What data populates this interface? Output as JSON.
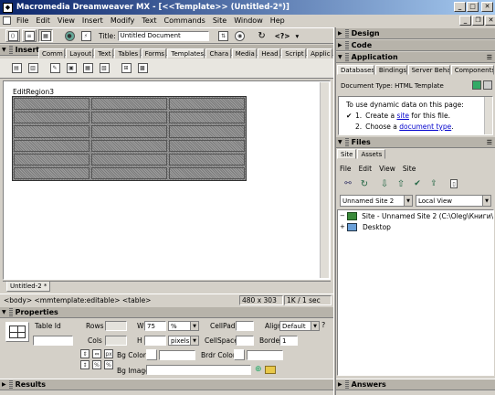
{
  "window": {
    "title": "Macromedia Dreamweaver MX - [<<Template>> (Untitled-2*)]"
  },
  "menu": [
    "File",
    "Edit",
    "View",
    "Insert",
    "Modify",
    "Text",
    "Commands",
    "Site",
    "Window",
    "Hep"
  ],
  "doc_toolbar": {
    "title_label": "Title:",
    "title_value": "Untitled Document",
    "codenav": "<?>"
  },
  "insert_panel": {
    "header": "Insert",
    "tabs": [
      "Comm",
      "Layout",
      "Text",
      "Tables",
      "Forms",
      "Templates",
      "Chara",
      "Media",
      "Head",
      "Script",
      "Applic"
    ],
    "active_tab": "Templates"
  },
  "document": {
    "region_label": "EditRegion3",
    "table_rows": 6,
    "table_cols": 3,
    "tab": "Untitled-2 *"
  },
  "status": {
    "path": "<body> <mmtemplate:editable> <table>",
    "size": "480 x 303",
    "info": "1K / 1 sec"
  },
  "properties": {
    "header": "Properties",
    "table_label": "Table Id",
    "rows_label": "Rows",
    "cols_label": "Cols",
    "w_label": "W",
    "w_value": "75",
    "w_unit": "%",
    "h_label": "H",
    "h_unit": "pixels",
    "cellpad_label": "CellPad",
    "cellspace_label": "CellSpace",
    "align_label": "Align",
    "align_value": "Default",
    "border_label": "Border",
    "border_value": "1",
    "bgcolor_label": "Bg Color",
    "brdrcolor_label": "Brdr Color",
    "bgimage_label": "Bg Image"
  },
  "results": {
    "header": "Results"
  },
  "right": {
    "design": "Design",
    "code": "Code",
    "application": "Application",
    "app_tabs": [
      "Databases",
      "Bindings",
      "Server Beha",
      "Components"
    ],
    "doc_type": "Document Type: HTML Template",
    "app_intro": "To use dynamic data on this page:",
    "app_steps": [
      {
        "num": "1.",
        "pre": "Create a ",
        "link": "site",
        "post": " for this file."
      },
      {
        "num": "2.",
        "pre": "Choose a ",
        "link": "document type",
        "post": "."
      }
    ],
    "files": "Files",
    "files_tabs": [
      "Site",
      "Assets"
    ],
    "files_menu": [
      "File",
      "Edit",
      "View",
      "Site"
    ],
    "site_select": "Unnamed Site 2",
    "view_select": "Local View",
    "tree": [
      {
        "label": "Site - Unnamed Site 2 (C:\\Oleg\\Книги\\...",
        "icon": "folder-icon"
      },
      {
        "label": "Desktop",
        "icon": "desktop-icon"
      }
    ],
    "answers": "Answers"
  }
}
